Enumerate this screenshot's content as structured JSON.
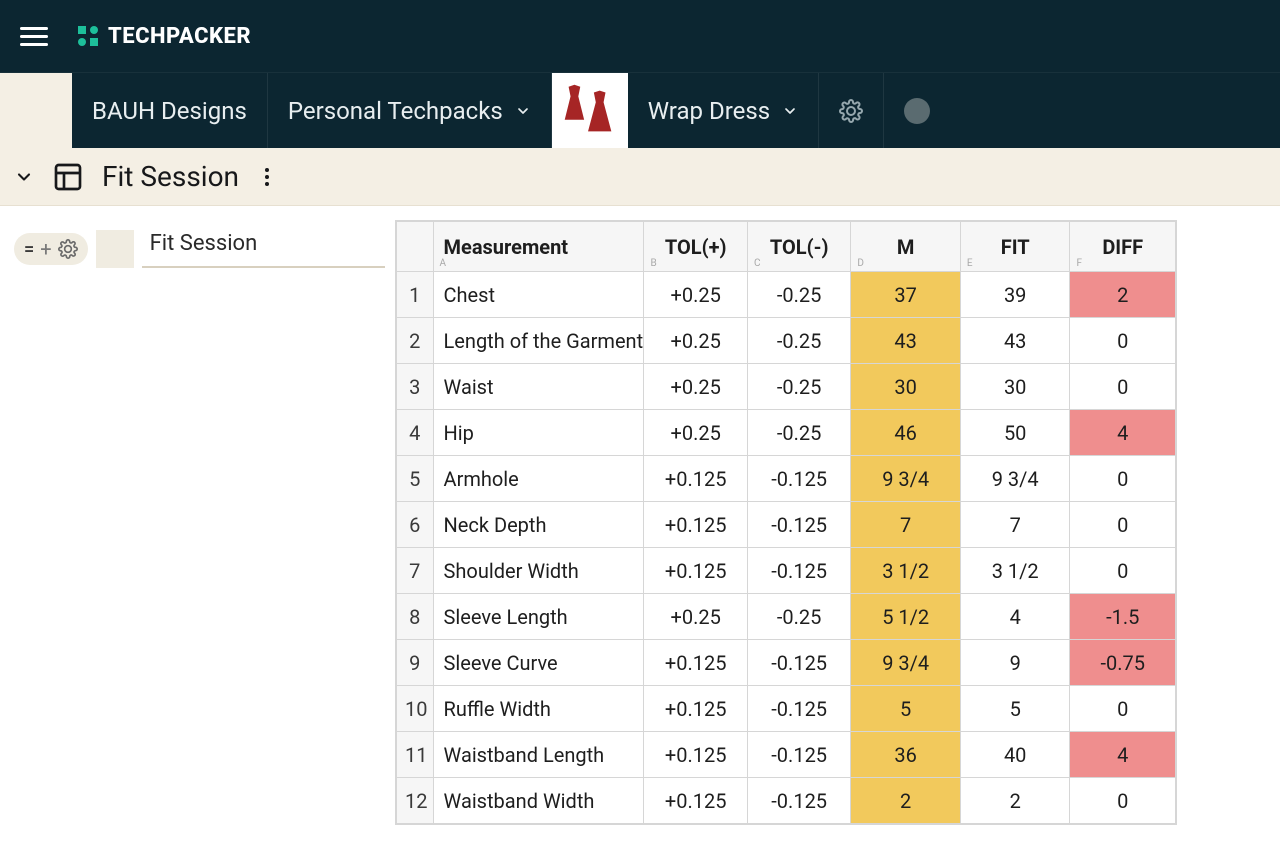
{
  "app": {
    "name": "TECHPACKER"
  },
  "breadcrumb": {
    "org": "BAUH Designs",
    "folder": "Personal Techpacks",
    "item": "Wrap Dress"
  },
  "section": {
    "title": "Fit Session"
  },
  "sidebar": {
    "node_label": "Fit Session"
  },
  "table": {
    "headers": {
      "measurement": "Measurement",
      "tol_plus": "TOL(+)",
      "tol_minus": "TOL(-)",
      "m": "M",
      "fit": "FIT",
      "diff": "DIFF"
    },
    "col_letters": {
      "a": "A",
      "b": "B",
      "c": "C",
      "d": "D",
      "e": "E",
      "f": "F"
    },
    "rows": [
      {
        "n": "1",
        "name": "Chest",
        "tolp": "+0.25",
        "tolm": "-0.25",
        "m": "37",
        "fit": "39",
        "diff": "2",
        "diff_red": true
      },
      {
        "n": "2",
        "name": "Length of the Garment",
        "tolp": "+0.25",
        "tolm": "-0.25",
        "m": "43",
        "fit": "43",
        "diff": "0",
        "diff_red": false
      },
      {
        "n": "3",
        "name": "Waist",
        "tolp": "+0.25",
        "tolm": "-0.25",
        "m": "30",
        "fit": "30",
        "diff": "0",
        "diff_red": false
      },
      {
        "n": "4",
        "name": "Hip",
        "tolp": "+0.25",
        "tolm": "-0.25",
        "m": "46",
        "fit": "50",
        "diff": "4",
        "diff_red": true
      },
      {
        "n": "5",
        "name": "Armhole",
        "tolp": "+0.125",
        "tolm": "-0.125",
        "m": "9 3/4",
        "fit": "9 3/4",
        "diff": "0",
        "diff_red": false
      },
      {
        "n": "6",
        "name": "Neck Depth",
        "tolp": "+0.125",
        "tolm": "-0.125",
        "m": "7",
        "fit": "7",
        "diff": "0",
        "diff_red": false
      },
      {
        "n": "7",
        "name": "Shoulder Width",
        "tolp": "+0.125",
        "tolm": "-0.125",
        "m": "3 1/2",
        "fit": "3 1/2",
        "diff": "0",
        "diff_red": false
      },
      {
        "n": "8",
        "name": "Sleeve Length",
        "tolp": "+0.25",
        "tolm": "-0.25",
        "m": "5 1/2",
        "fit": "4",
        "diff": "-1.5",
        "diff_red": true
      },
      {
        "n": "9",
        "name": "Sleeve Curve",
        "tolp": "+0.125",
        "tolm": "-0.125",
        "m": "9 3/4",
        "fit": "9",
        "diff": "-0.75",
        "diff_red": true
      },
      {
        "n": "10",
        "name": "Ruffle Width",
        "tolp": "+0.125",
        "tolm": "-0.125",
        "m": "5",
        "fit": "5",
        "diff": "0",
        "diff_red": false
      },
      {
        "n": "11",
        "name": "Waistband Length",
        "tolp": "+0.125",
        "tolm": "-0.125",
        "m": "36",
        "fit": "40",
        "diff": "4",
        "diff_red": true
      },
      {
        "n": "12",
        "name": "Waistband Width",
        "tolp": "+0.125",
        "tolm": "-0.125",
        "m": "2",
        "fit": "2",
        "diff": "0",
        "diff_red": false
      }
    ]
  }
}
